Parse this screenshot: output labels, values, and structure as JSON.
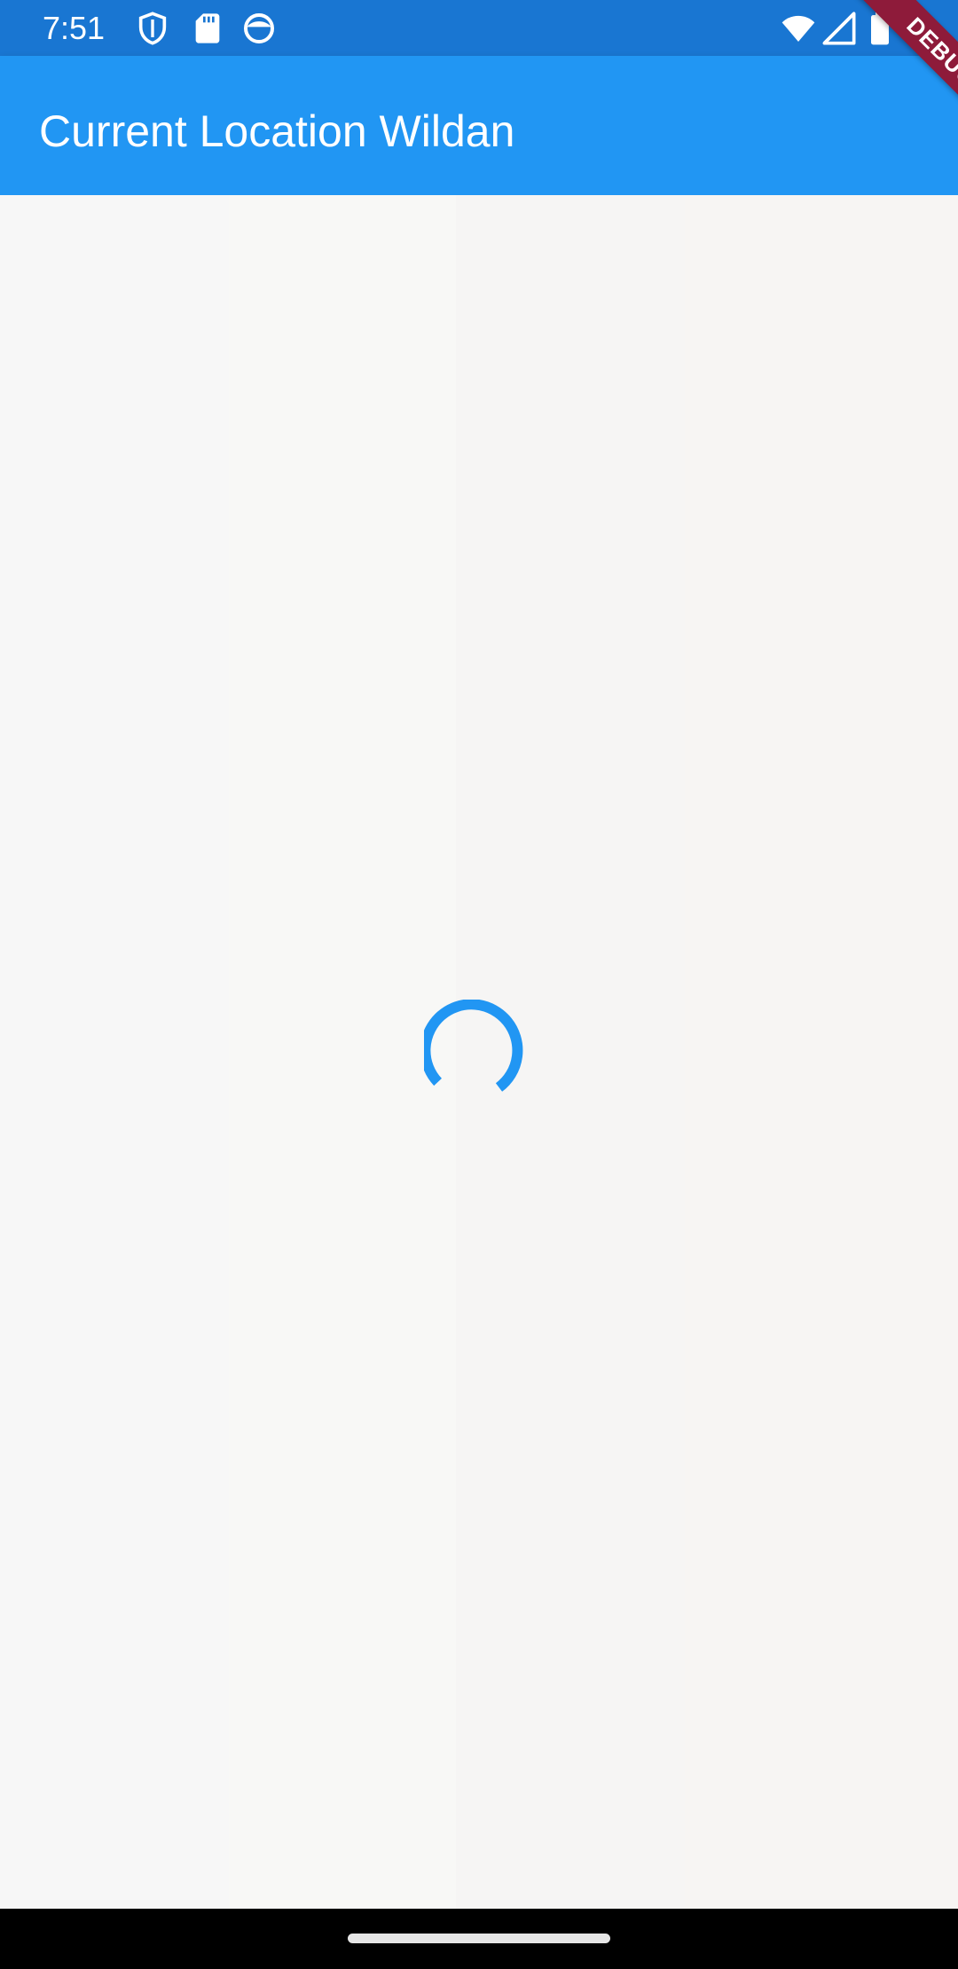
{
  "status_bar": {
    "time": "7:51",
    "left_icons": [
      "shield-icon",
      "sd-card-icon",
      "face-icon"
    ],
    "right_icons": [
      "wifi-icon",
      "cell-signal-icon",
      "battery-icon"
    ],
    "color": "#1976d2"
  },
  "app_bar": {
    "title": "Current Location Wildan",
    "color": "#2196f3"
  },
  "content": {
    "loading": true,
    "spinner_color": "#2196f3"
  },
  "debug_banner": {
    "label": "DEBUG",
    "color": "#8e1b3a"
  },
  "nav_bar": {
    "handle": "gesture-handle"
  }
}
